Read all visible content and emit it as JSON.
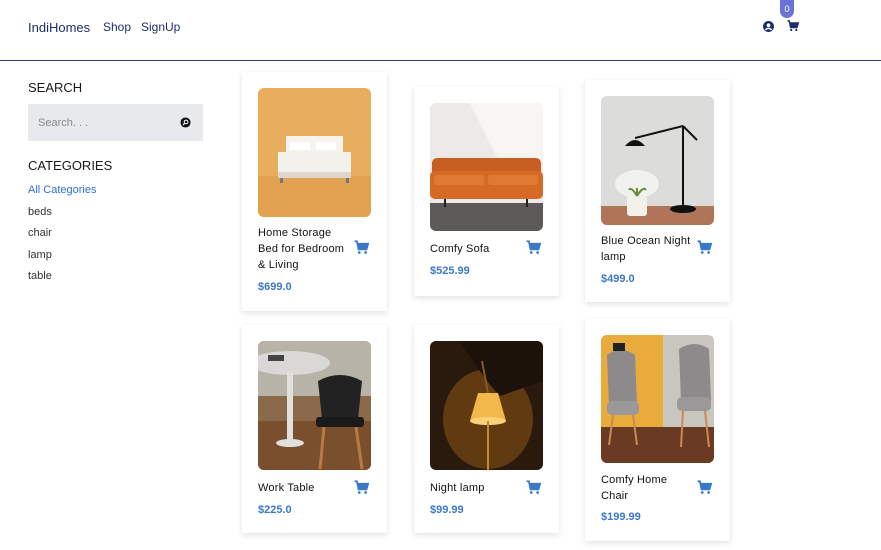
{
  "header": {
    "brand": "IndiHomes",
    "nav": [
      "Shop",
      "SignUp"
    ],
    "cart_count": "0",
    "icons": [
      "user-circle-icon",
      "shopping-cart-icon"
    ]
  },
  "sidebar": {
    "search_title": "SEARCH",
    "search_placeholder": "Search. . .",
    "categories_title": "CATEGORIES",
    "categories": [
      "All Categories",
      "beds",
      "chair",
      "lamp",
      "table"
    ]
  },
  "products": [
    {
      "name": "Home Storage Bed for Bedroom & Living",
      "price": "$699.0"
    },
    {
      "name": "Comfy Sofa",
      "price": "$525.99"
    },
    {
      "name": "Blue Ocean Night lamp",
      "price": "$499.0"
    },
    {
      "name": "Work Table",
      "price": "$225.0"
    },
    {
      "name": "Night lamp",
      "price": "$99.99"
    },
    {
      "name": "Comfy Home Chair",
      "price": "$199.99"
    }
  ],
  "colors": {
    "brand": "#1f2d6b",
    "accent": "#2f6fd6",
    "price": "#3b78c9",
    "badge": "#6b74d6"
  }
}
